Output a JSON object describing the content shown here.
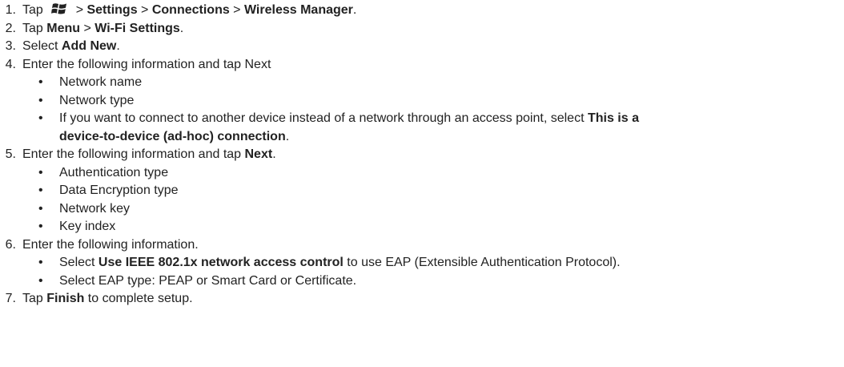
{
  "steps": [
    {
      "number": "1.",
      "parts": [
        {
          "t": "Tap "
        },
        {
          "icon": "windows-start-icon"
        },
        {
          "t": " > "
        },
        {
          "t": "Settings",
          "b": true
        },
        {
          "t": " > "
        },
        {
          "t": "Connections",
          "b": true
        },
        {
          "t": " > "
        },
        {
          "t": "Wireless Manager",
          "b": true
        },
        {
          "t": "."
        }
      ]
    },
    {
      "number": "2.",
      "parts": [
        {
          "t": "Tap "
        },
        {
          "t": "Menu",
          "b": true
        },
        {
          "t": " > "
        },
        {
          "t": "Wi-Fi Settings",
          "b": true
        },
        {
          "t": "."
        }
      ]
    },
    {
      "number": "3.",
      "parts": [
        {
          "t": "Select "
        },
        {
          "t": "Add New",
          "b": true
        },
        {
          "t": "."
        }
      ]
    },
    {
      "number": "4.",
      "parts": [
        {
          "t": "Enter the following information and tap Next"
        }
      ],
      "bullets": [
        [
          {
            "t": "Network name"
          }
        ],
        [
          {
            "t": "Network type"
          }
        ],
        [
          {
            "t": "If you want to connect to another device instead of a network through an access point, select "
          },
          {
            "t": "This is a",
            "b": true
          },
          {
            "br": true
          },
          {
            "t": "device-to-device (ad-hoc) connection",
            "b": true
          },
          {
            "t": "."
          }
        ]
      ]
    },
    {
      "number": "5.",
      "parts": [
        {
          "t": "Enter the following information and tap "
        },
        {
          "t": "Next",
          "b": true
        },
        {
          "t": "."
        }
      ],
      "bullets": [
        [
          {
            "t": "Authentication type"
          }
        ],
        [
          {
            "t": "Data Encryption type"
          }
        ],
        [
          {
            "t": "Network key"
          }
        ],
        [
          {
            "t": "Key index"
          }
        ]
      ]
    },
    {
      "number": "6.",
      "parts": [
        {
          "t": "Enter the following information."
        }
      ],
      "bullets": [
        [
          {
            "t": "Select "
          },
          {
            "t": "Use IEEE 802.1x network access control",
            "b": true
          },
          {
            "t": " to use EAP (Extensible Authentication Protocol)."
          }
        ],
        [
          {
            "t": "Select EAP type: PEAP or Smart Card or Certificate."
          }
        ]
      ]
    },
    {
      "number": "7.",
      "parts": [
        {
          "t": "Tap "
        },
        {
          "t": "Finish",
          "b": true
        },
        {
          "t": " to complete setup."
        }
      ]
    }
  ],
  "bullet_char": "•"
}
